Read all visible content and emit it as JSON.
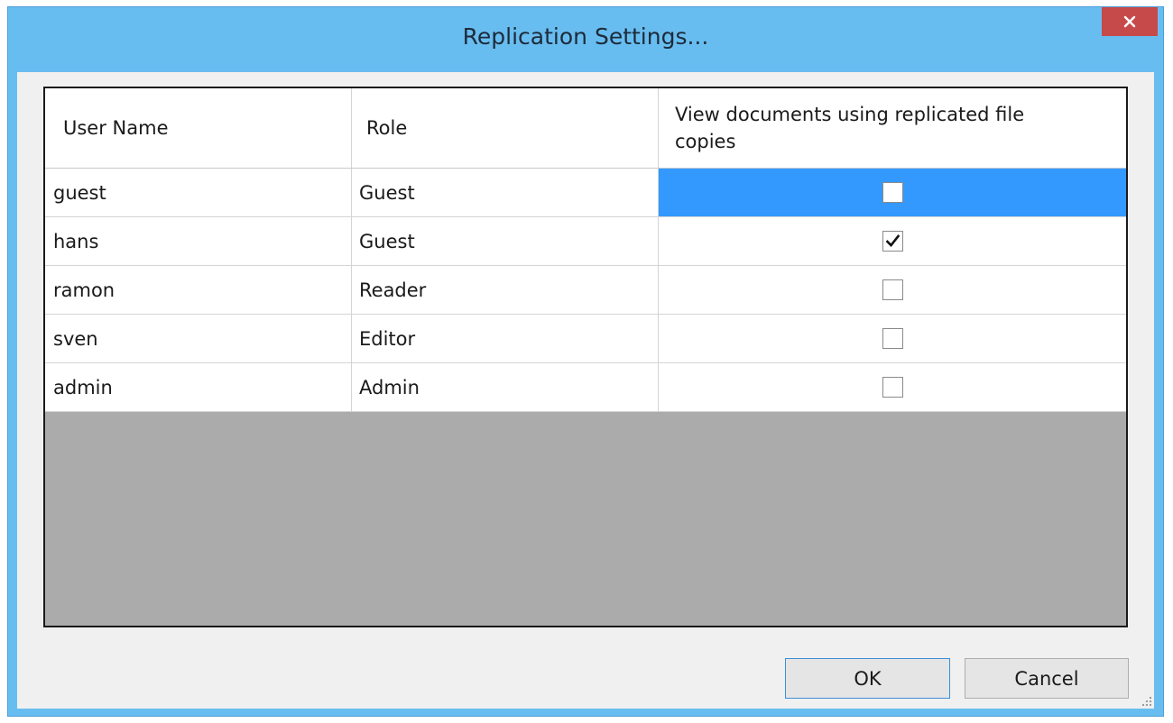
{
  "window": {
    "title": "Replication Settings...",
    "close_symbol": "×",
    "close_icon": "close-icon",
    "accent_color": "#68bdf0",
    "close_color": "#c74a4a",
    "selection_color": "#3399ff"
  },
  "grid": {
    "columns": [
      "User Name",
      "Role",
      "View documents using replicated file copies"
    ],
    "rows": [
      {
        "user": "guest",
        "role": "Guest",
        "view_replicated": false,
        "selected": true
      },
      {
        "user": "hans",
        "role": "Guest",
        "view_replicated": true,
        "selected": false
      },
      {
        "user": "ramon",
        "role": "Reader",
        "view_replicated": false,
        "selected": false
      },
      {
        "user": "sven",
        "role": "Editor",
        "view_replicated": false,
        "selected": false
      },
      {
        "user": "admin",
        "role": "Admin",
        "view_replicated": false,
        "selected": false
      }
    ]
  },
  "buttons": {
    "ok_label": "OK",
    "cancel_label": "Cancel"
  },
  "icons": {
    "check": "check-icon",
    "resize_grip": "resize-grip-icon"
  }
}
